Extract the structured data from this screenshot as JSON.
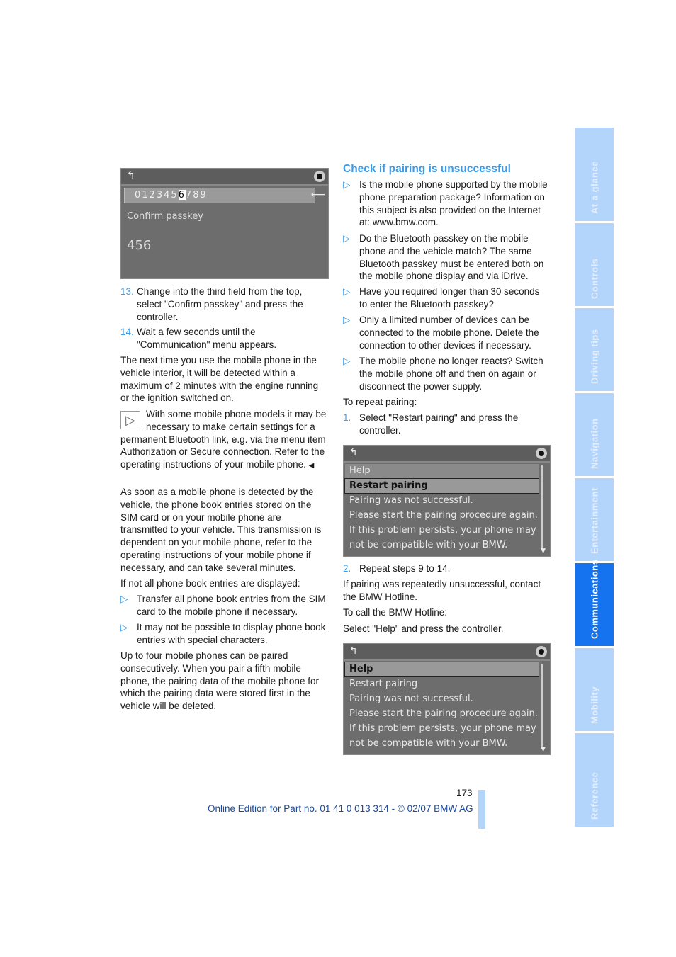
{
  "screen1": {
    "digits_before": "012345",
    "digit_selected": "6",
    "digits_after": "789",
    "enter_icon": "arrow-left-enter-icon",
    "label": "Confirm passkey",
    "value": "456"
  },
  "left": {
    "step13": {
      "num": "13.",
      "text": "Change into the third field from the top, select \"Confirm passkey\" and press the controller."
    },
    "step14": {
      "num": "14.",
      "text": "Wait a few seconds until the \"Communication\" menu appears."
    },
    "para1": "The next time you use the mobile phone in the vehicle interior, it will be detected within a maximum of 2 minutes with the engine running or the ignition switched on.",
    "note": "With some mobile phone models it may be necessary to make certain settings for a permanent Bluetooth link, e.g. via the menu item Authorization or Secure connection. Refer to the operating instructions of your mobile phone.",
    "note_end": "◀",
    "para2": "As soon as a mobile phone is detected by the vehicle, the phone book entries stored on the SIM card or on your mobile phone are transmitted to your vehicle. This transmission is dependent on your mobile phone, refer to the operating instructions of your mobile phone if necessary, and can take several minutes.",
    "para3": "If not all phone book entries are displayed:",
    "bullets": [
      "Transfer all phone book entries from the SIM card to the mobile phone if necessary.",
      "It may not be possible to display phone book entries with special characters."
    ],
    "para4": "Up to four mobile phones can be paired consecutively. When you pair a fifth mobile phone, the pairing data of the mobile phone for which the pairing data were stored first in the vehicle will be deleted."
  },
  "right": {
    "heading": "Check if pairing is unsuccessful",
    "bullet_marker": "▷",
    "bullets": [
      "Is the mobile phone supported by the mobile phone preparation package? Information on this subject is also provided on the Internet at: www.bmw.com.",
      "Do the Bluetooth passkey on the mobile phone and the vehicle match? The same Bluetooth passkey must be entered both on the mobile phone display and via iDrive.",
      "Have you required longer than 30 seconds to enter the Bluetooth passkey?",
      "Only a limited number of devices can be connected to the mobile phone. Delete the connection to other devices if necessary.",
      "The mobile phone no longer reacts? Switch the mobile phone off and then on again or disconnect the power supply."
    ],
    "repeat_label": "To repeat pairing:",
    "step1": {
      "num": "1.",
      "text": "Select \"Restart pairing\" and press the controller."
    },
    "step2": {
      "num": "2.",
      "text": "Repeat steps 9 to 14."
    },
    "para1": "If pairing was repeatedly unsuccessful, contact the BMW Hotline.",
    "para2": "To call the BMW Hotline:",
    "para3": "Select \"Help\" and press the controller."
  },
  "screen2": {
    "items": [
      "Help",
      "Restart pairing",
      "Pairing was not successful.",
      "Please start the pairing procedure again.",
      "If this problem persists, your phone may",
      "not be compatible with your BMW."
    ],
    "selected": "Restart pairing"
  },
  "screen3": {
    "items": [
      "Help",
      "Restart pairing",
      "Pairing was not successful.",
      "Please start the pairing procedure again.",
      "If this problem persists, your phone may",
      "not be compatible with your BMW."
    ],
    "selected": "Help"
  },
  "footer": {
    "page_number": "173",
    "edition": "Online Edition for Part no. 01 41 0 013 314 - © 02/07 BMW AG"
  },
  "tabs": [
    {
      "label": "At a glance",
      "active": false
    },
    {
      "label": "Controls",
      "active": false
    },
    {
      "label": "Driving tips",
      "active": false
    },
    {
      "label": "Navigation",
      "active": false
    },
    {
      "label": "Entertainment",
      "active": false
    },
    {
      "label": "Communications",
      "active": true
    },
    {
      "label": "Mobility",
      "active": false
    },
    {
      "label": "Reference",
      "active": false
    }
  ],
  "colors": {
    "accent": "#3c9be6",
    "tab": "#b3d4fb",
    "tab_active": "#1673f0",
    "screen_bg": "#6d6d6d"
  }
}
